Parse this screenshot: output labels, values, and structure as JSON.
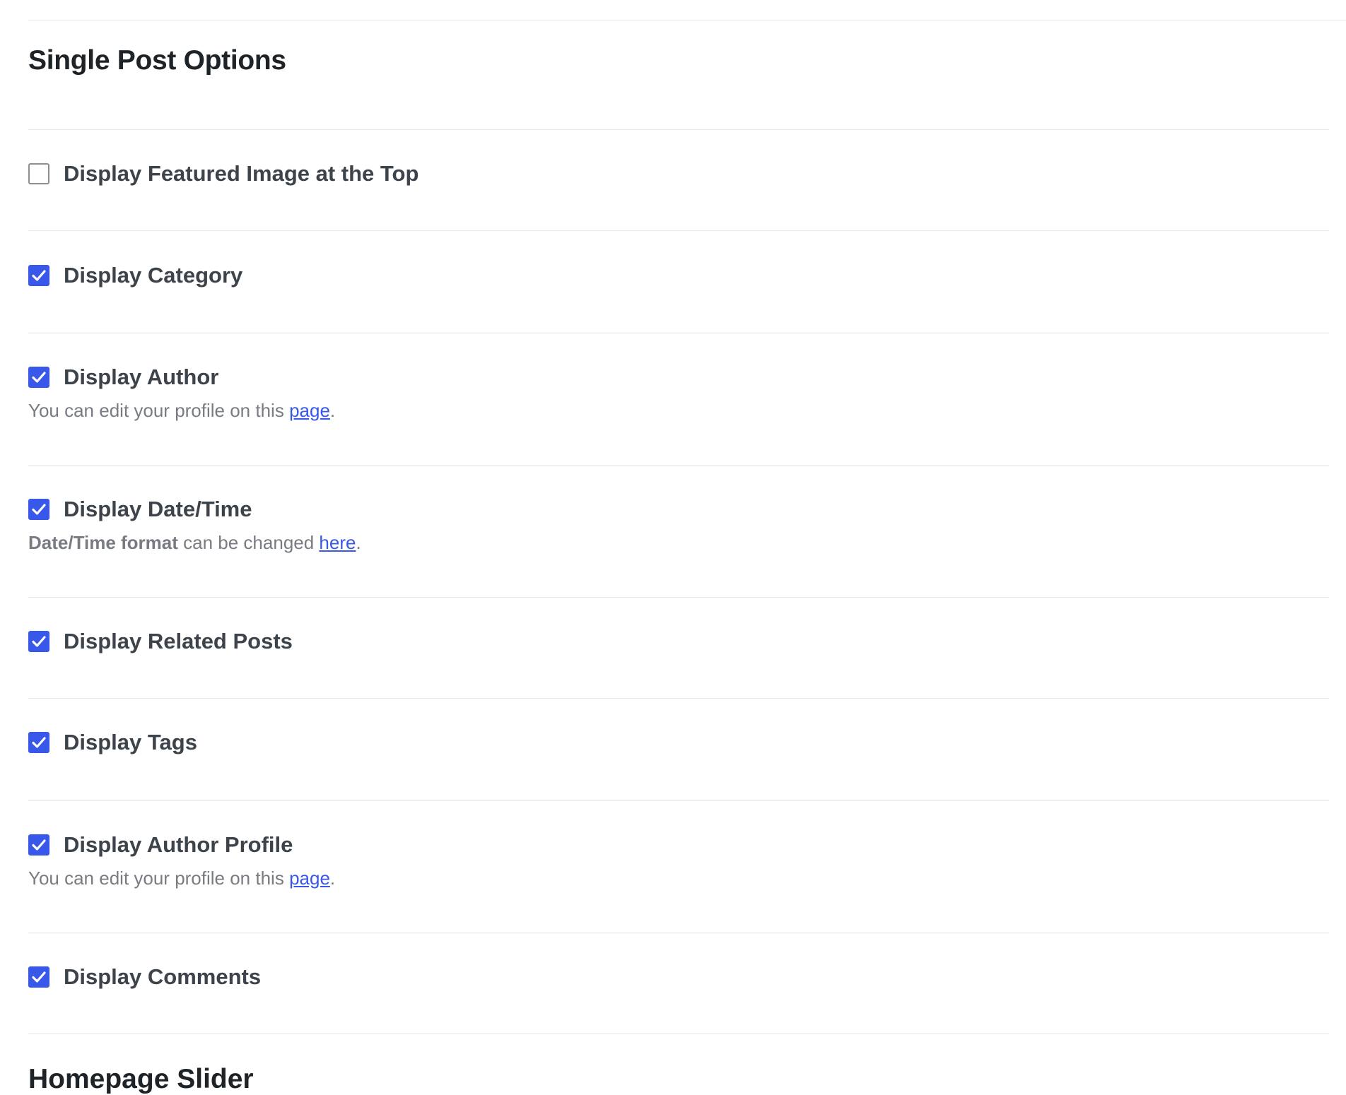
{
  "section": {
    "title": "Single Post Options"
  },
  "options": [
    {
      "label": "Display Featured Image at the Top",
      "checked": false
    },
    {
      "label": "Display Category",
      "checked": true
    },
    {
      "label": "Display Author",
      "checked": true,
      "desc_prefix": "You can edit your profile on this ",
      "desc_link": "page",
      "desc_suffix": "."
    },
    {
      "label": "Display Date/Time",
      "checked": true,
      "desc_bold": "Date/Time format",
      "desc_prefix": " can be changed ",
      "desc_link": "here",
      "desc_suffix": "."
    },
    {
      "label": "Display Related Posts",
      "checked": true
    },
    {
      "label": "Display Tags",
      "checked": true
    },
    {
      "label": "Display Author Profile",
      "checked": true,
      "desc_prefix": "You can edit your profile on this ",
      "desc_link": "page",
      "desc_suffix": "."
    },
    {
      "label": "Display Comments",
      "checked": true
    }
  ],
  "next_section": {
    "title": "Homepage Slider"
  },
  "colors": {
    "checkbox_checked": "#3858e9",
    "link": "#3858e9",
    "label_text": "#3c434a",
    "description_text": "#787c82",
    "divider": "#e7e8ea"
  }
}
